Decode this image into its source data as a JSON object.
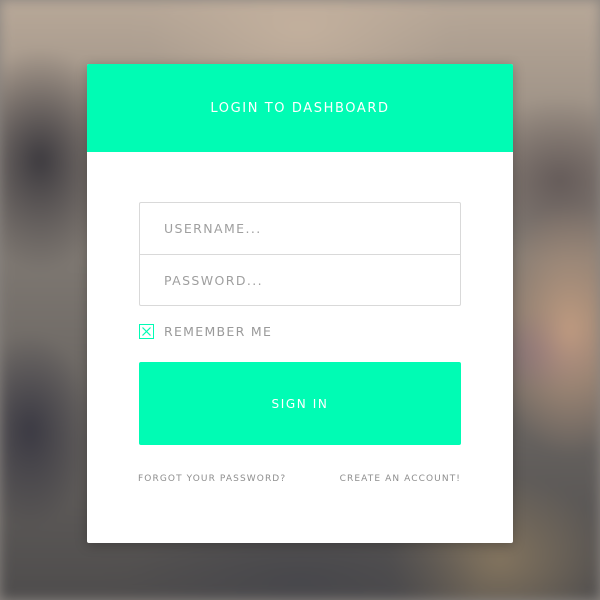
{
  "login": {
    "title": "LOGIN TO DASHBOARD",
    "username_placeholder": "USERNAME...",
    "password_placeholder": "PASSWORD...",
    "remember_label": "REMEMBER ME",
    "remember_checked": true,
    "signin_label": "SIGN IN",
    "forgot_link": "FORGOT YOUR PASSWORD?",
    "create_link": "CREATE AN ACCOUNT!"
  },
  "colors": {
    "accent": "#00fcb4",
    "card": "#ffffff",
    "muted_text": "#9a9a9a",
    "border": "#d9d9d9"
  },
  "icons": {
    "checkbox": "check-x-icon"
  }
}
